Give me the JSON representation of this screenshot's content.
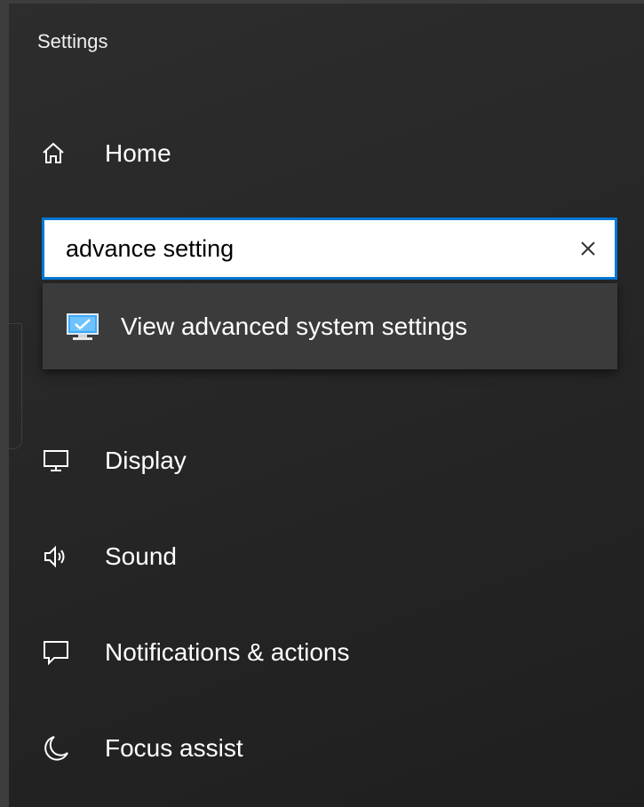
{
  "app": {
    "title": "Settings"
  },
  "home": {
    "label": "Home",
    "icon": "home-icon"
  },
  "search": {
    "value": "advance setting",
    "placeholder": "",
    "clear_icon": "close-icon"
  },
  "suggestions": [
    {
      "label": "View advanced system settings",
      "icon": "system-monitor-icon"
    }
  ],
  "nav": {
    "items": [
      {
        "label": "Display",
        "icon": "display-icon"
      },
      {
        "label": "Sound",
        "icon": "speaker-icon"
      },
      {
        "label": "Notifications & actions",
        "icon": "notification-icon"
      },
      {
        "label": "Focus assist",
        "icon": "moon-icon"
      }
    ]
  },
  "colors": {
    "accent": "#0078d7",
    "background": "#262626",
    "text": "#ffffff",
    "suggestion_bg": "#3b3b3b"
  }
}
